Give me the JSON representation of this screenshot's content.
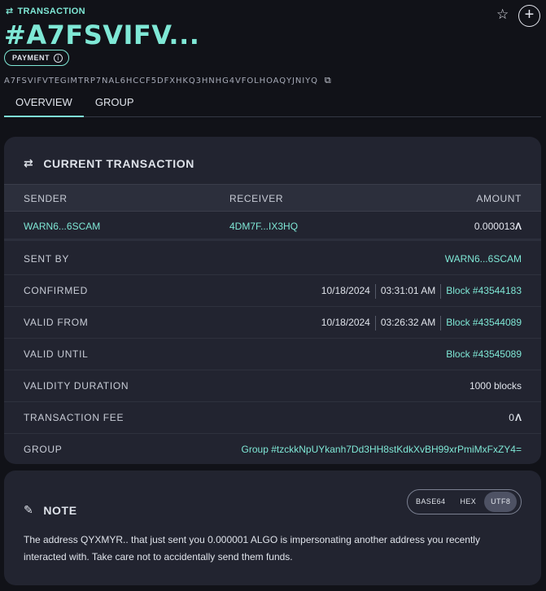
{
  "header": {
    "kind_label": "TRANSACTION",
    "title": "#A7FSVIFV...",
    "type_pill": "PAYMENT",
    "full_id": "A7FSVIFVTEGIMTRP7NAL6HCCF5DFXHKQ3HNHG4VFOLHOAQYJNIYQ"
  },
  "tabs": [
    "OVERVIEW",
    "GROUP"
  ],
  "current_transaction": {
    "heading": "CURRENT TRANSACTION",
    "columns": [
      "SENDER",
      "RECEIVER",
      "AMOUNT"
    ],
    "row": {
      "sender": "WARN6...6SCAM",
      "receiver": "4DM7F...IX3HQ",
      "amount": "0.000013"
    },
    "details": {
      "sent_by": {
        "label": "SENT BY",
        "value": "WARN6...6SCAM"
      },
      "confirmed": {
        "label": "CONFIRMED",
        "date": "10/18/2024",
        "time": "03:31:01 AM",
        "block": "Block #43544183"
      },
      "valid_from": {
        "label": "VALID FROM",
        "date": "10/18/2024",
        "time": "03:26:32 AM",
        "block": "Block #43544089"
      },
      "valid_until": {
        "label": "VALID UNTIL",
        "block": "Block #43545089"
      },
      "validity_duration": {
        "label": "VALIDITY DURATION",
        "value": "1000 blocks"
      },
      "transaction_fee": {
        "label": "TRANSACTION FEE",
        "value": "0"
      },
      "group": {
        "label": "GROUP",
        "value": "Group #tzckkNpUYkanh7Dd3HH8stKdkXvBH99xrPmiMxFxZY4="
      }
    }
  },
  "note": {
    "heading": "NOTE",
    "encodings": [
      "BASE64",
      "HEX",
      "UTF8"
    ],
    "selected_encoding": "UTF8",
    "text": "The address QYXMYR.. that just sent you 0.000001 ALGO is impersonating another address you recently interacted with. Take care not to accidentally send them funds."
  },
  "colors": {
    "accent": "#7fe8d6",
    "background": "#111218",
    "card": "#222430"
  }
}
